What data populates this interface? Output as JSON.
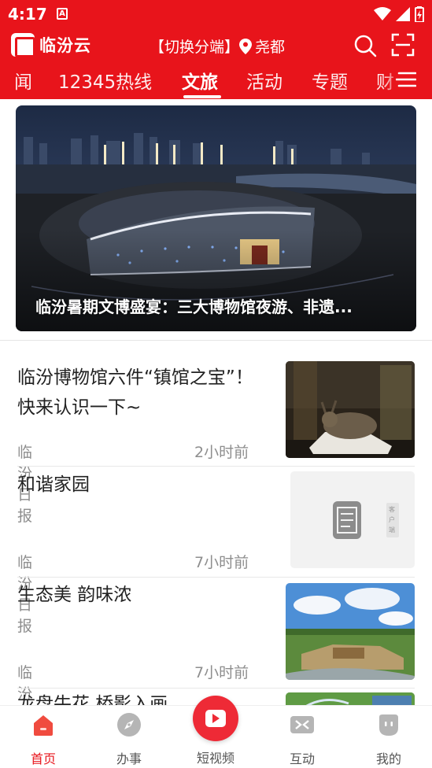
{
  "status": {
    "time": "4:17",
    "notification_letter": "A"
  },
  "header": {
    "app_name": "临汾云",
    "switch_label": "【切换分端】",
    "location": "尧都"
  },
  "tabs": [
    {
      "label": "闻"
    },
    {
      "label": "12345热线"
    },
    {
      "label": "文旅",
      "active": true
    },
    {
      "label": "活动"
    },
    {
      "label": "专题"
    },
    {
      "label": "财"
    }
  ],
  "banner": {
    "title": "临汾暑期文博盛宴：三大博物馆夜游、非遗..."
  },
  "news": [
    {
      "title": "临汾博物馆六件“镇馆之宝”！快来认识一下~",
      "source": "临汾日报",
      "time": "2小时前"
    },
    {
      "title": "和谐家园",
      "source": "临汾日报",
      "time": "7小时前",
      "thumb_side_text": "客户端"
    },
    {
      "title": "生态美 韵味浓",
      "source": "临汾日报",
      "time": "7小时前"
    },
    {
      "title": "龙盘牛花 桥影入画"
    }
  ],
  "bottom_nav": [
    {
      "label": "首页",
      "icon": "home-icon",
      "active": true
    },
    {
      "label": "办事",
      "icon": "compass-icon"
    },
    {
      "label": "短视频",
      "icon": "play-icon"
    },
    {
      "label": "互动",
      "icon": "interact-icon"
    },
    {
      "label": "我的",
      "icon": "profile-icon"
    }
  ],
  "colors": {
    "brand_red": "#e8141b",
    "meta_gray": "#8e8e8e",
    "nav_inactive": "#b5b5b5"
  }
}
